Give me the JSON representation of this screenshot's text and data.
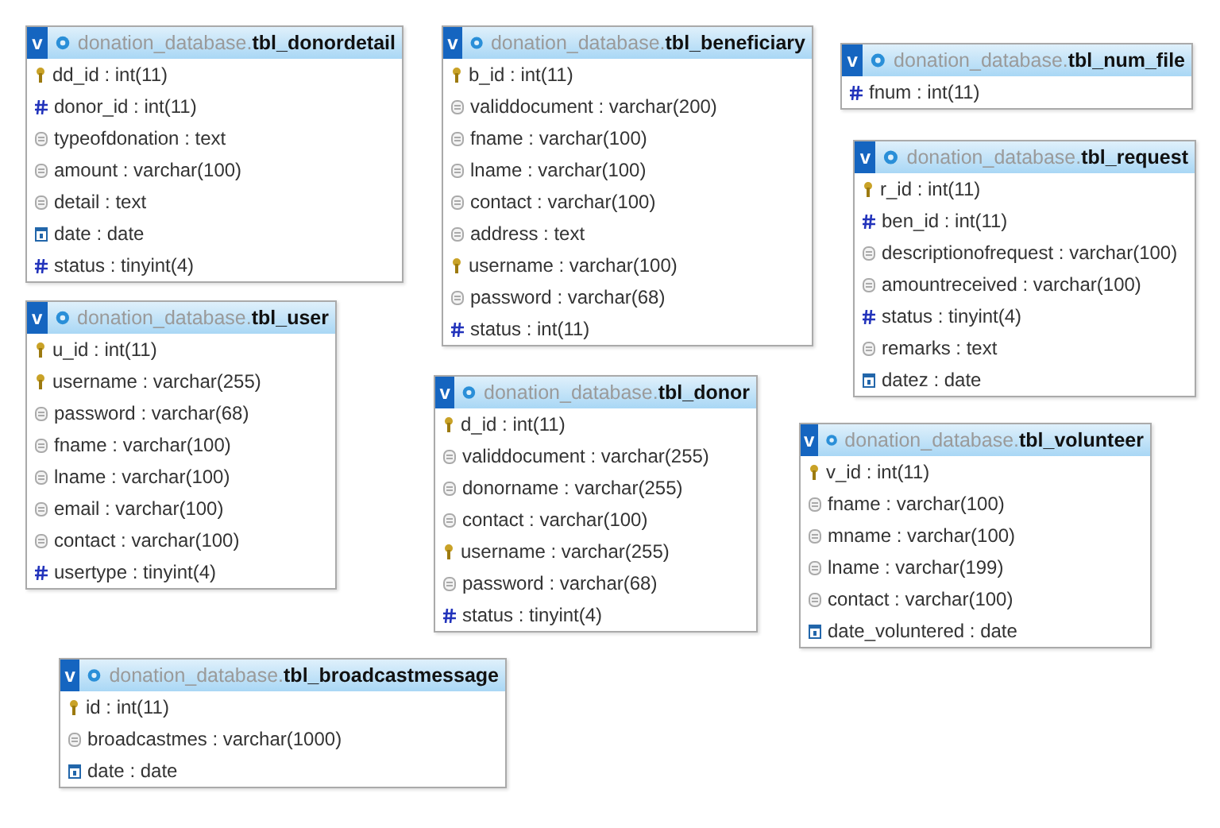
{
  "tables": [
    {
      "toggle": "v",
      "db": "donation_database.",
      "name": "tbl_donordetail",
      "columns": [
        {
          "kind": "key",
          "text": "dd_id : int(11)"
        },
        {
          "kind": "number",
          "text": "donor_id : int(11)"
        },
        {
          "kind": "text",
          "text": "typeofdonation : text"
        },
        {
          "kind": "text",
          "text": "amount : varchar(100)"
        },
        {
          "kind": "text",
          "text": "detail : text"
        },
        {
          "kind": "date",
          "text": "date : date"
        },
        {
          "kind": "number",
          "text": "status : tinyint(4)"
        }
      ]
    },
    {
      "toggle": "v",
      "db": "donation_database.",
      "name": "tbl_beneficiary",
      "columns": [
        {
          "kind": "key",
          "text": "b_id : int(11)"
        },
        {
          "kind": "text",
          "text": "validdocument : varchar(200)"
        },
        {
          "kind": "text",
          "text": "fname : varchar(100)"
        },
        {
          "kind": "text",
          "text": "lname : varchar(100)"
        },
        {
          "kind": "text",
          "text": "contact : varchar(100)"
        },
        {
          "kind": "text",
          "text": "address : text"
        },
        {
          "kind": "key",
          "text": "username : varchar(100)"
        },
        {
          "kind": "text",
          "text": "password : varchar(68)"
        },
        {
          "kind": "number",
          "text": "status : int(11)"
        }
      ]
    },
    {
      "toggle": "v",
      "db": "donation_database.",
      "name": "tbl_num_file",
      "columns": [
        {
          "kind": "number",
          "text": "fnum : int(11)"
        }
      ]
    },
    {
      "toggle": "v",
      "db": "donation_database.",
      "name": "tbl_request",
      "columns": [
        {
          "kind": "key",
          "text": "r_id : int(11)"
        },
        {
          "kind": "number",
          "text": "ben_id : int(11)"
        },
        {
          "kind": "text",
          "text": "descriptionofrequest : varchar(100)"
        },
        {
          "kind": "text",
          "text": "amountreceived : varchar(100)"
        },
        {
          "kind": "number",
          "text": "status : tinyint(4)"
        },
        {
          "kind": "text",
          "text": "remarks : text"
        },
        {
          "kind": "date",
          "text": "datez : date"
        }
      ]
    },
    {
      "toggle": "v",
      "db": "donation_database.",
      "name": "tbl_user",
      "columns": [
        {
          "kind": "key",
          "text": "u_id : int(11)"
        },
        {
          "kind": "key",
          "text": "username : varchar(255)"
        },
        {
          "kind": "text",
          "text": "password : varchar(68)"
        },
        {
          "kind": "text",
          "text": "fname : varchar(100)"
        },
        {
          "kind": "text",
          "text": "lname : varchar(100)"
        },
        {
          "kind": "text",
          "text": "email : varchar(100)"
        },
        {
          "kind": "text",
          "text": "contact : varchar(100)"
        },
        {
          "kind": "number",
          "text": "usertype : tinyint(4)"
        }
      ]
    },
    {
      "toggle": "v",
      "db": "donation_database.",
      "name": "tbl_donor",
      "columns": [
        {
          "kind": "key",
          "text": "d_id : int(11)"
        },
        {
          "kind": "text",
          "text": "validdocument : varchar(255)"
        },
        {
          "kind": "text",
          "text": "donorname : varchar(255)"
        },
        {
          "kind": "text",
          "text": "contact : varchar(100)"
        },
        {
          "kind": "key",
          "text": "username : varchar(255)"
        },
        {
          "kind": "text",
          "text": "password : varchar(68)"
        },
        {
          "kind": "number",
          "text": "status : tinyint(4)"
        }
      ]
    },
    {
      "toggle": "v",
      "db": "donation_database.",
      "name": "tbl_volunteer",
      "columns": [
        {
          "kind": "key",
          "text": "v_id : int(11)"
        },
        {
          "kind": "text",
          "text": "fname : varchar(100)"
        },
        {
          "kind": "text",
          "text": "mname : varchar(100)"
        },
        {
          "kind": "text",
          "text": "lname : varchar(199)"
        },
        {
          "kind": "text",
          "text": "contact : varchar(100)"
        },
        {
          "kind": "date",
          "text": "date_voluntered : date"
        }
      ]
    },
    {
      "toggle": "v",
      "db": "donation_database.",
      "name": "tbl_broadcastmessage",
      "columns": [
        {
          "kind": "key",
          "text": "id : int(11)"
        },
        {
          "kind": "text",
          "text": "broadcastmes : varchar(1000)"
        },
        {
          "kind": "date",
          "text": "date : date"
        }
      ]
    }
  ]
}
